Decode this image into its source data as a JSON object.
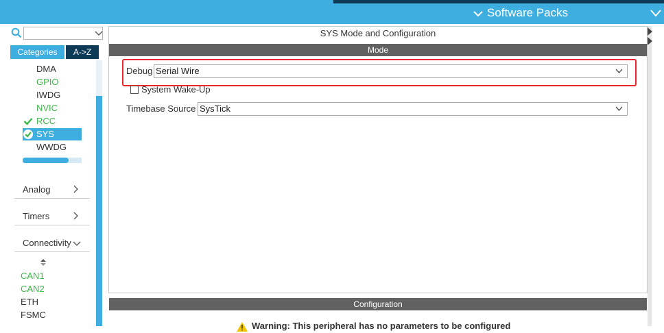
{
  "header": {
    "software_packs_label": "Software Packs"
  },
  "left": {
    "search": {
      "value": "",
      "placeholder": ""
    },
    "tabs": {
      "categories": "Categories",
      "a_z": "A->Z"
    },
    "system_core_items": [
      {
        "label": "DMA",
        "status": "default"
      },
      {
        "label": "GPIO",
        "status": "configured"
      },
      {
        "label": "IWDG",
        "status": "default"
      },
      {
        "label": "NVIC",
        "status": "configured"
      },
      {
        "label": "RCC",
        "status": "ok"
      },
      {
        "label": "SYS",
        "status": "selected"
      },
      {
        "label": "WWDG",
        "status": "default"
      }
    ],
    "categories": [
      {
        "label": "Analog",
        "state": "collapsed"
      },
      {
        "label": "Timers",
        "state": "collapsed"
      },
      {
        "label": "Connectivity",
        "state": "expanded"
      }
    ],
    "connectivity_items": [
      {
        "label": "CAN1",
        "status": "configured"
      },
      {
        "label": "CAN2",
        "status": "configured"
      },
      {
        "label": "ETH",
        "status": "default"
      },
      {
        "label": "FSMC",
        "status": "default"
      }
    ]
  },
  "main": {
    "title": "SYS Mode and Configuration",
    "mode_header": "Mode",
    "debug": {
      "label": "Debug",
      "value": "Serial Wire"
    },
    "system_wakeup": {
      "label": "System Wake-Up",
      "checked": false
    },
    "timebase": {
      "label": "Timebase Source",
      "value": "SysTick"
    },
    "configuration_header": "Configuration",
    "warning": "Warning: This peripheral has no parameters to be configured"
  },
  "colors": {
    "accent": "#3eaee0",
    "dark_navy": "#0d3a57",
    "section_header": "#616161",
    "configured_green": "#3cb84a",
    "highlight_red": "#e8262c"
  },
  "icons": {
    "search": "search-icon",
    "check": "check-icon",
    "check_circle": "check-circle-icon",
    "chevron_down": "chevron-down-icon",
    "chevron_right": "chevron-right-icon",
    "warning": "warning-icon"
  }
}
